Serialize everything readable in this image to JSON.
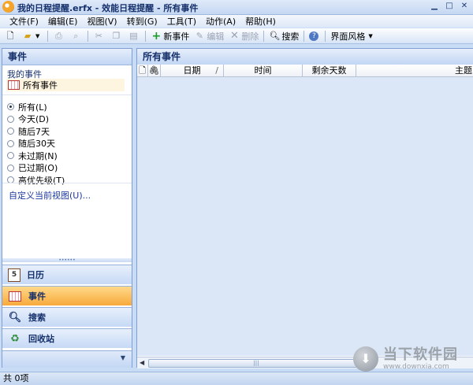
{
  "window": {
    "title": "我的日程提醒.erfx - 效能日程提醒 - 所有事件"
  },
  "menu": [
    "文件(F)",
    "编辑(E)",
    "视图(V)",
    "转到(G)",
    "工具(T)",
    "动作(A)",
    "帮助(H)"
  ],
  "toolbar": {
    "new_event": "新事件",
    "edit": "编辑",
    "delete": "删除",
    "search": "搜索",
    "skin": "界面风格"
  },
  "left": {
    "header": "事件",
    "my_events": "我的事件",
    "all_events": "所有事件",
    "filters": [
      "所有(L)",
      "今天(D)",
      "随后7天",
      "随后30天",
      "未过期(N)",
      "已过期(O)",
      "高优先级(T)"
    ],
    "selected_filter": "所有(L)",
    "custom_view": "自定义当前视图(U)...",
    "nav": [
      "日历",
      "事件",
      "搜索",
      "回收站"
    ],
    "active_nav": "事件"
  },
  "right": {
    "header": "所有事件",
    "columns": [
      "日期",
      "时间",
      "剩余天数",
      "主题"
    ]
  },
  "status": {
    "text": "共 0项"
  },
  "watermark": {
    "cn": "当下软件园",
    "en": "www.downxia.com"
  }
}
